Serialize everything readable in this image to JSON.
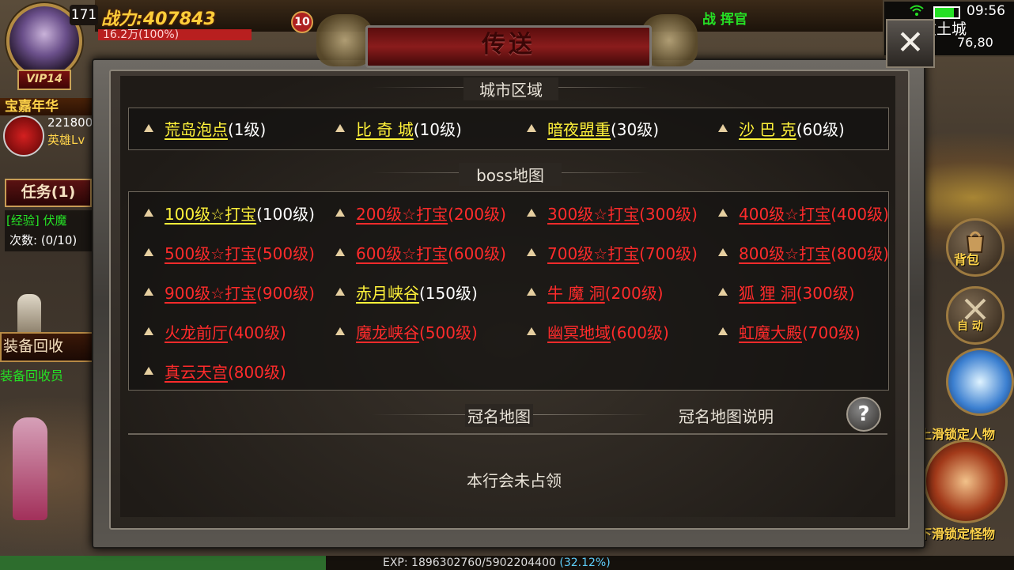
{
  "hud": {
    "level": "171",
    "power_label": "战力:",
    "power_value": "407843",
    "hp_text": "16.2万(100%)",
    "vip": "VIP14",
    "event_title": "宝嘉年华",
    "event_number": "221800",
    "event_hero": "英雄Lv",
    "task_button": "任务(1)",
    "task_tag": "[经验]  伏魔",
    "task_count": "次数:  (0/10)",
    "recycle_button": "装备回收",
    "recycle_npc": "装备回收员",
    "top_green_text": "战",
    "badge_count": "10",
    "commander_text": "战  挥官"
  },
  "status": {
    "time": "09:56",
    "map_name": "盟重土城",
    "coords": "76,80",
    "wifi_icon": "wifi-icon",
    "battery_icon": "battery-icon"
  },
  "right_buttons": {
    "bag": "背包",
    "auto": "自 动",
    "lock_player": "上滑锁定人物",
    "lock_monster": "下滑锁定怪物"
  },
  "exp": {
    "label": "EXP: 1896302760/5902204400",
    "percent": "(32.12%)",
    "fraction": 0.3212
  },
  "dialog": {
    "title": "传送",
    "close_label": "✕",
    "sections": {
      "city": "城市区域",
      "boss": "boss地图",
      "crown": "冠名地图",
      "crown_help": "冠名地图说明"
    },
    "city_entries": [
      {
        "name": "荒岛泡点",
        "level": "(1级)"
      },
      {
        "name": "比 奇 城",
        "level": "(10级)"
      },
      {
        "name": "暗夜盟重",
        "level": "(30级)"
      },
      {
        "name": "沙 巴 克",
        "level": "(60级)"
      }
    ],
    "boss_entries": [
      {
        "name": "100级☆打宝",
        "level": "(100级)",
        "style": "y"
      },
      {
        "name": "200级☆打宝",
        "level": "(200级)",
        "style": "r"
      },
      {
        "name": "300级☆打宝",
        "level": "(300级)",
        "style": "r"
      },
      {
        "name": "400级☆打宝",
        "level": "(400级)",
        "style": "r"
      },
      {
        "name": "500级☆打宝",
        "level": "(500级)",
        "style": "r"
      },
      {
        "name": "600级☆打宝",
        "level": "(600级)",
        "style": "r"
      },
      {
        "name": "700级☆打宝",
        "level": "(700级)",
        "style": "r"
      },
      {
        "name": "800级☆打宝",
        "level": "(800级)",
        "style": "r"
      },
      {
        "name": "900级☆打宝",
        "level": "(900级)",
        "style": "r"
      },
      {
        "name": "赤月峡谷",
        "level": "(150级)",
        "style": "y"
      },
      {
        "name": "牛 魔 洞",
        "level": "(200级)",
        "style": "r"
      },
      {
        "name": "狐 狸 洞",
        "level": "(300级)",
        "style": "r"
      },
      {
        "name": "火龙前厅",
        "level": "(400级)",
        "style": "r"
      },
      {
        "name": "魔龙峡谷",
        "level": "(500级)",
        "style": "r"
      },
      {
        "name": "幽冥地域",
        "level": "(600级)",
        "style": "r"
      },
      {
        "name": "虹魔大殿",
        "level": "(700级)",
        "style": "r"
      },
      {
        "name": "真云天宫",
        "level": "(800级)",
        "style": "r"
      }
    ],
    "crown_status": "本行会未占领",
    "help_label": "?"
  }
}
